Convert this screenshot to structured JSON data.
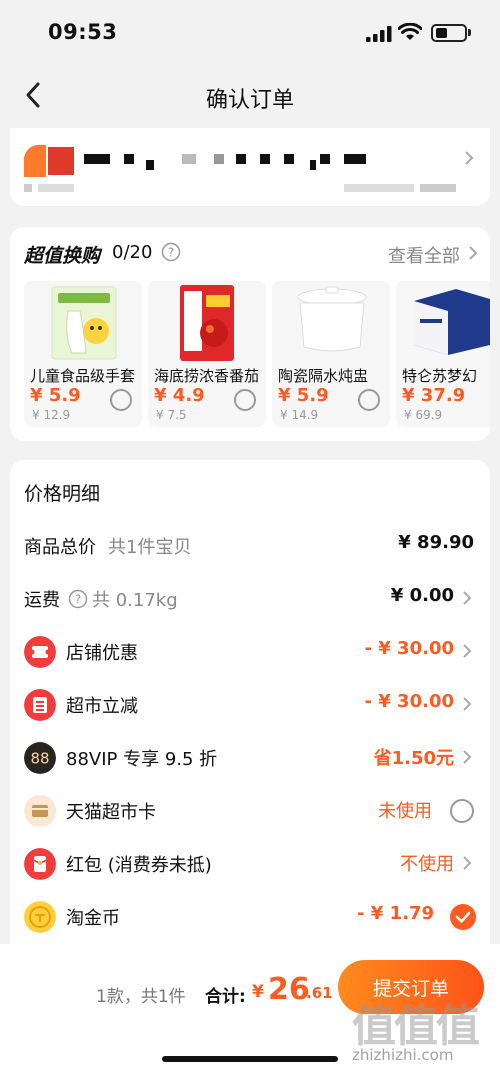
{
  "status_bar": {
    "time": "09:53"
  },
  "nav": {
    "title": "确认订单"
  },
  "upgrade": {
    "title": "超值换购",
    "count": "0/20",
    "view_all": "查看全部",
    "products": [
      {
        "name": "儿童食品级手套",
        "price": "¥ 5.9",
        "original": "¥ 12.9"
      },
      {
        "name": "海底捞浓香番茄",
        "price": "¥ 4.9",
        "original": "¥ 7.5"
      },
      {
        "name": "陶瓷隔水炖盅",
        "price": "¥ 5.9",
        "original": "¥ 14.9"
      },
      {
        "name": "特仑苏梦幻",
        "price": "¥ 37.9",
        "original": "¥ 69.9"
      }
    ]
  },
  "price_detail": {
    "title": "价格明细",
    "total_goods": {
      "label": "商品总价",
      "sub": "共1件宝贝",
      "value": "¥ 89.90"
    },
    "shipping": {
      "label": "运费",
      "sub": "共 0.17kg",
      "value": "¥ 0.00"
    },
    "store_discount": {
      "label": "店铺优惠",
      "value": "- ¥ 30.00"
    },
    "market_discount": {
      "label": "超市立减",
      "value": "- ¥ 30.00"
    },
    "vip": {
      "label": "88VIP 专享 9.5 折",
      "value": "省1.50元"
    },
    "card": {
      "label": "天猫超市卡",
      "value": "未使用"
    },
    "redpacket": {
      "label": "红包 (消费券未抵)",
      "value": "不使用"
    },
    "coin": {
      "label": "淘金币",
      "value": "- ¥ 1.79"
    }
  },
  "footer": {
    "summary": "1款，共1件",
    "total_label": "合计:",
    "currency": "¥",
    "total_int": "26",
    "total_dec": ".61",
    "submit": "提交订单"
  },
  "watermark": {
    "text": "值值值",
    "site": "zhizhizhi.com"
  },
  "colors": {
    "accent": "#ff5a1f",
    "background": "#f2f2f3"
  }
}
